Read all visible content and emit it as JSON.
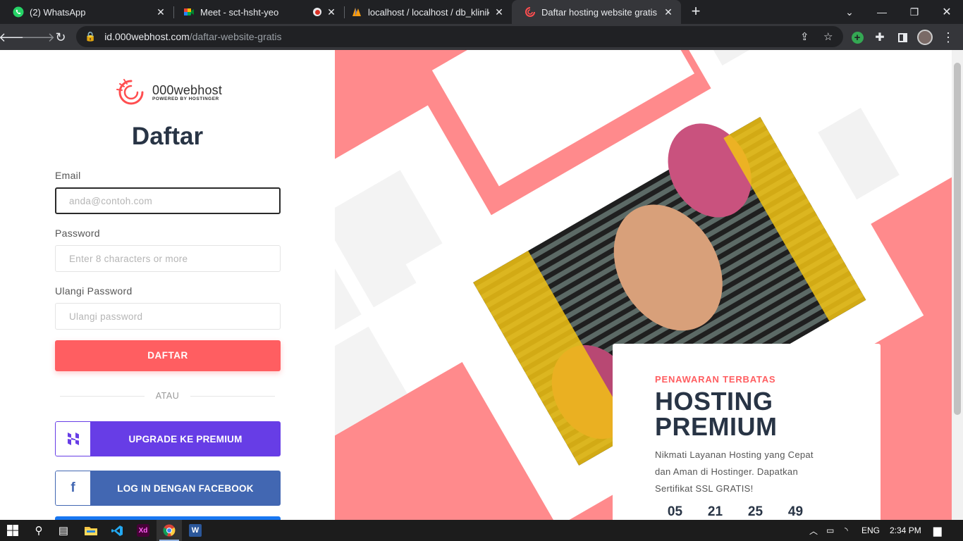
{
  "browser": {
    "tabs": [
      {
        "title": "(2) WhatsApp",
        "icon": "whatsapp-icon",
        "active": false
      },
      {
        "title": "Meet - sct-hsht-yeo",
        "icon": "google-meet-icon",
        "active": false
      },
      {
        "title": "localhost / localhost / db_klinik | p",
        "icon": "phpmyadmin-icon",
        "active": false
      },
      {
        "title": "Daftar hosting website gratis seka",
        "icon": "000webhost-icon",
        "active": true
      }
    ],
    "url_host": "id.000webhost.com",
    "url_path": "/daftar-website-gratis"
  },
  "page": {
    "logo": {
      "name": "000webhost",
      "tagline": "POWERED BY HOSTINGER"
    },
    "heading": "Daftar",
    "form": {
      "email_label": "Email",
      "email_placeholder": "anda@contoh.com",
      "password_label": "Password",
      "password_placeholder": "Enter 8 characters or more",
      "repeat_label": "Ulangi Password",
      "repeat_placeholder": "Ulangi password",
      "submit_label": "DAFTAR"
    },
    "divider": "ATAU",
    "social": [
      {
        "label": "UPGRADE KE PREMIUM",
        "icon": "hostinger-icon",
        "color": "#673de6"
      },
      {
        "label": "LOG IN DENGAN FACEBOOK",
        "icon": "facebook-icon",
        "color": "#4267b2"
      }
    ],
    "promo": {
      "kicker": "PENAWARAN TERBATAS",
      "title_line1": "HOSTING",
      "title_line2": "PREMIUM",
      "description": "Nikmati Layanan Hosting yang Cepat dan Aman di Hostinger. Dapatkan Sertifikat SSL GRATIS!",
      "countdown": [
        "05",
        "21",
        "25",
        "49"
      ]
    },
    "accent_color": "#ff5e61",
    "hero_bg_color": "#ff8a8c"
  },
  "taskbar": {
    "apps": [
      "windows-icon",
      "search-icon",
      "task-view-icon",
      "file-explorer-icon",
      "vscode-icon",
      "adobe-xd-icon",
      "chrome-icon",
      "word-icon"
    ],
    "language": "ENG",
    "time": "2:34 PM"
  }
}
